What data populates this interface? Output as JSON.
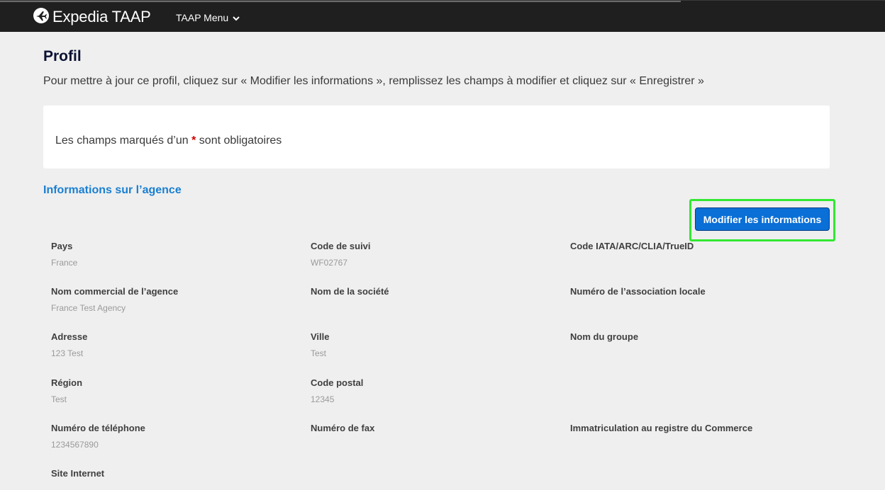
{
  "header": {
    "brand": "Expedia TAAP",
    "menu_label": "TAAP Menu"
  },
  "page": {
    "title": "Profil",
    "intro": "Pour mettre à jour ce profil, cliquez sur « Modifier les informations », remplissez les champs à modifier et cliquez sur « Enregistrer »"
  },
  "notice": {
    "before": "Les champs marqués d’un ",
    "star": "*",
    "after": " sont obligatoires"
  },
  "section": {
    "title": "Informations sur l’agence",
    "edit_button": "Modifier les informations"
  },
  "fields": {
    "pays": {
      "label": "Pays",
      "value": "France"
    },
    "code_suivi": {
      "label": "Code de suivi",
      "value": "WF02767"
    },
    "code_iata": {
      "label": "Code IATA/ARC/CLIA/TrueID",
      "value": ""
    },
    "nom_commercial": {
      "label": "Nom commercial de l’agence",
      "value": "France Test Agency"
    },
    "nom_societe": {
      "label": "Nom de la société",
      "value": ""
    },
    "numero_association": {
      "label": "Numéro de l’association locale",
      "value": ""
    },
    "adresse": {
      "label": "Adresse",
      "value": "123 Test"
    },
    "ville": {
      "label": "Ville",
      "value": "Test"
    },
    "nom_groupe": {
      "label": "Nom du groupe",
      "value": ""
    },
    "region": {
      "label": "Région",
      "value": "Test"
    },
    "code_postal": {
      "label": "Code postal",
      "value": "12345"
    },
    "telephone": {
      "label": "Numéro de téléphone",
      "value": "1234567890"
    },
    "fax": {
      "label": "Numéro de fax",
      "value": ""
    },
    "registre_commerce": {
      "label": "Immatriculation au registre du Commerce",
      "value": ""
    },
    "site_internet": {
      "label": "Site Internet",
      "value": ""
    }
  },
  "colors": {
    "topbar": "#1f1f1f",
    "accent_blue": "#1a7fd1",
    "button_blue": "#0a6fd6",
    "highlight_green": "#33e833",
    "required_red": "#d40000"
  },
  "icons": {
    "logo": "plane-logo-icon",
    "menu_toggle": "chevron-down-icon"
  }
}
